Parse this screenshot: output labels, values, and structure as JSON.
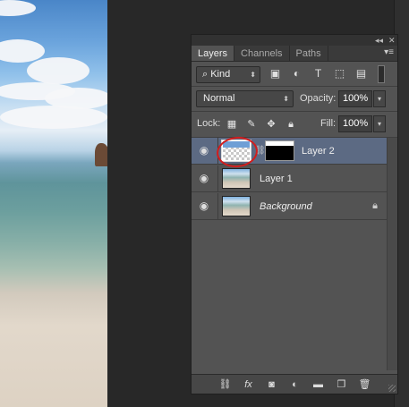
{
  "panel": {
    "tabs": [
      {
        "label": "Layers",
        "active": true
      },
      {
        "label": "Channels",
        "active": false
      },
      {
        "label": "Paths",
        "active": false
      }
    ],
    "collapse_label": "◂◂",
    "close_label": "✕",
    "menu_icon": "panel-menu-icon"
  },
  "filter": {
    "kind_label": "Kind",
    "icons": [
      "image-filter-icon",
      "adjustment-filter-icon",
      "type-filter-icon",
      "shape-filter-icon",
      "smart-object-filter-icon"
    ]
  },
  "blend": {
    "mode": "Normal",
    "opacity_label": "Opacity:",
    "opacity_value": "100%",
    "fill_label": "Fill:",
    "fill_value": "100%",
    "lock_label": "Lock:"
  },
  "layers": [
    {
      "name": "Layer 2",
      "selected": true,
      "has_mask": true,
      "italic": false,
      "locked": false
    },
    {
      "name": "Layer 1",
      "selected": false,
      "has_mask": false,
      "italic": false,
      "locked": false
    },
    {
      "name": "Background",
      "selected": false,
      "has_mask": false,
      "italic": true,
      "locked": true
    }
  ],
  "bottom_icons": [
    "link-layers-icon",
    "fx-icon",
    "add-mask-icon",
    "adjustment-layer-icon",
    "new-group-icon",
    "new-layer-icon",
    "delete-layer-icon"
  ],
  "colors": {
    "selected_row": "#5c6a83",
    "panel_bg": "#535353",
    "annotation_circle": "#d21d1d"
  }
}
